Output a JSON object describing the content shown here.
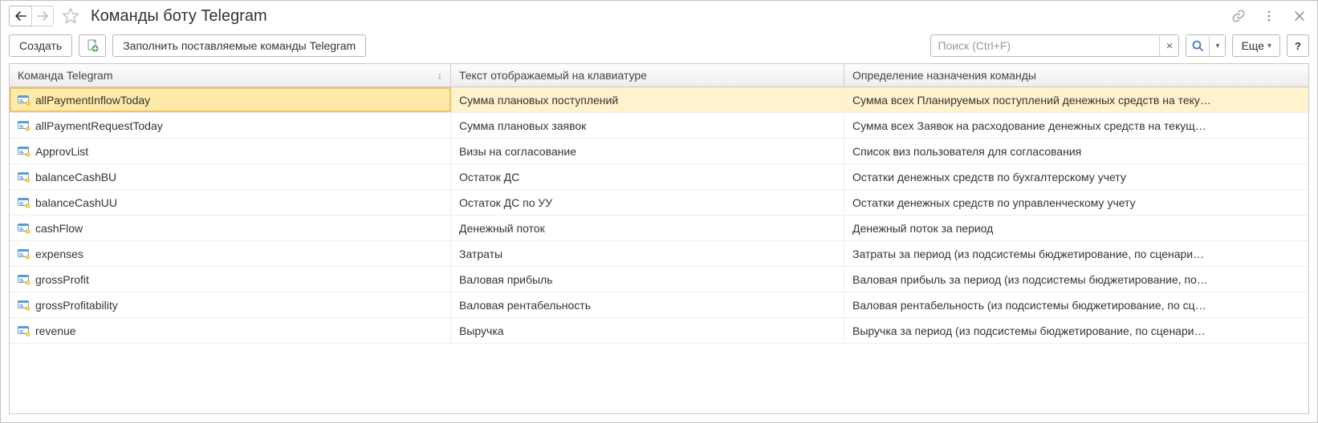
{
  "header": {
    "title": "Команды боту Telegram"
  },
  "toolbar": {
    "create_label": "Создать",
    "fill_label": "Заполнить поставляемые команды Telegram"
  },
  "search": {
    "placeholder": "Поиск (Ctrl+F)"
  },
  "more_label": "Еще",
  "help_label": "?",
  "table": {
    "columns": {
      "cmd": "Команда Telegram",
      "text": "Текст отображаемый на клавиатуре",
      "desc": "Определение назначения команды"
    },
    "rows": [
      {
        "cmd": "allPaymentInflowToday",
        "text": "Сумма плановых поступлений",
        "desc": "Сумма всех Планируемых поступлений денежных средств на теку…",
        "selected": true
      },
      {
        "cmd": "allPaymentRequestToday",
        "text": "Сумма плановых заявок",
        "desc": "Сумма всех Заявок на расходование денежных средств на текущ…"
      },
      {
        "cmd": "ApprovList",
        "text": "Визы на согласование",
        "desc": "Список виз пользователя для согласования"
      },
      {
        "cmd": "balanceCashBU",
        "text": "Остаток ДС",
        "desc": "Остатки денежных средств по бухгалтерскому учету"
      },
      {
        "cmd": "balanceCashUU",
        "text": "Остаток ДС по УУ",
        "desc": "Остатки денежных средств по управленческому учету"
      },
      {
        "cmd": "cashFlow",
        "text": "Денежный поток",
        "desc": "Денежный поток за период"
      },
      {
        "cmd": "expenses",
        "text": "Затраты",
        "desc": "Затраты за период (из подсистемы бюджетирование, по сценари…"
      },
      {
        "cmd": "grossProfit",
        "text": "Валовая прибыль",
        "desc": "Валовая прибыль за период (из подсистемы бюджетирование, по…"
      },
      {
        "cmd": "grossProfitability",
        "text": "Валовая рентабельность",
        "desc": "Валовая рентабельность (из подсистемы бюджетирование, по сц…"
      },
      {
        "cmd": "revenue",
        "text": "Выручка",
        "desc": "Выручка за период (из подсистемы бюджетирование, по сценари…"
      }
    ]
  }
}
